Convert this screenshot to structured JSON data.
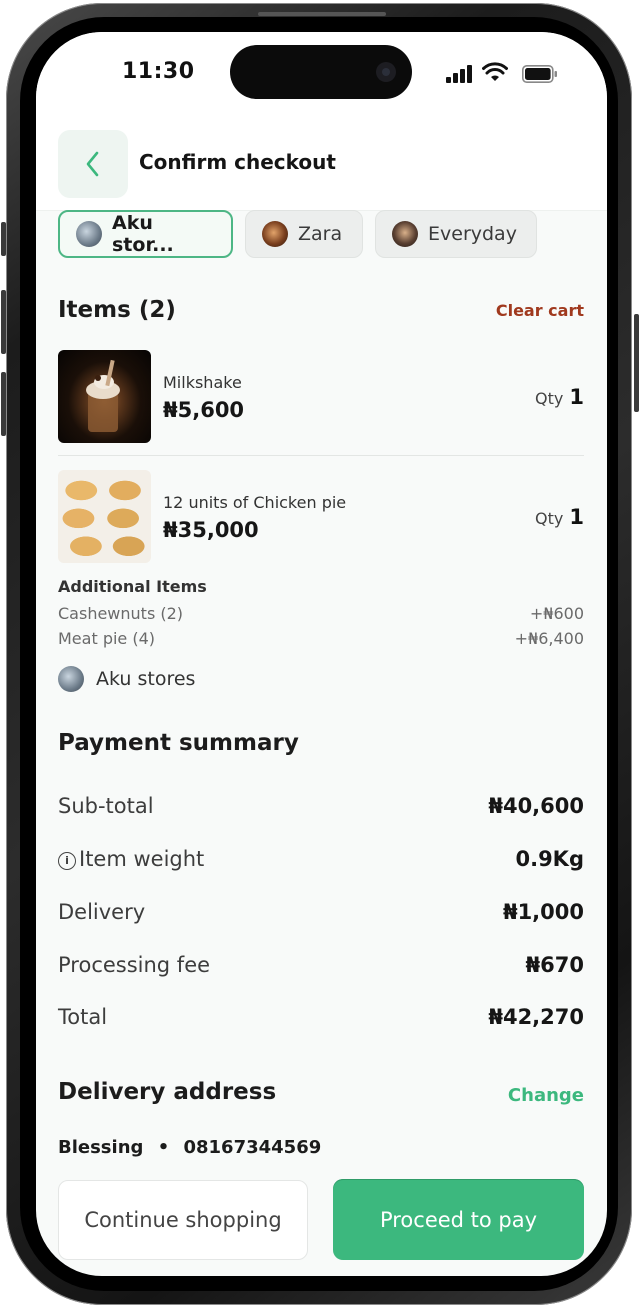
{
  "status_bar": {
    "time": "11:30"
  },
  "header": {
    "title": "Confirm checkout"
  },
  "stores": [
    {
      "label": "Aku stor...",
      "active": true
    },
    {
      "label": "Zara",
      "active": false
    },
    {
      "label": "Everyday",
      "active": false
    }
  ],
  "items_section": {
    "title": "Items (2)",
    "clear_label": "Clear cart"
  },
  "items": [
    {
      "name": "Milkshake",
      "price": "₦5,600",
      "qty_label": "Qty",
      "qty": "1"
    },
    {
      "name": "12 units of Chicken pie",
      "price": "₦35,000",
      "qty_label": "Qty",
      "qty": "1"
    }
  ],
  "additional": {
    "title": "Additional Items",
    "rows": [
      {
        "label": "Cashewnuts (2)",
        "value": "+₦600"
      },
      {
        "label": "Meat pie (4)",
        "value": "+₦6,400"
      }
    ]
  },
  "store_name": "Aku stores",
  "payment": {
    "title": "Payment summary",
    "rows": [
      {
        "label": "Sub-total",
        "value": "₦40,600"
      },
      {
        "label": "Item weight",
        "value": "0.9Kg"
      },
      {
        "label": "Delivery",
        "value": "₦1,000"
      },
      {
        "label": "Processing fee",
        "value": "₦670"
      },
      {
        "label": "Total",
        "value": "₦42,270"
      }
    ]
  },
  "delivery": {
    "title": "Delivery address",
    "change_label": "Change",
    "name": "Blessing",
    "separator": "•",
    "phone": "08167344569"
  },
  "actions": {
    "continue_label": "Continue shopping",
    "pay_label": "Proceed to pay"
  },
  "colors": {
    "accent": "#3cb87e",
    "danger_link": "#a0391e",
    "background": "#f8faf9"
  }
}
